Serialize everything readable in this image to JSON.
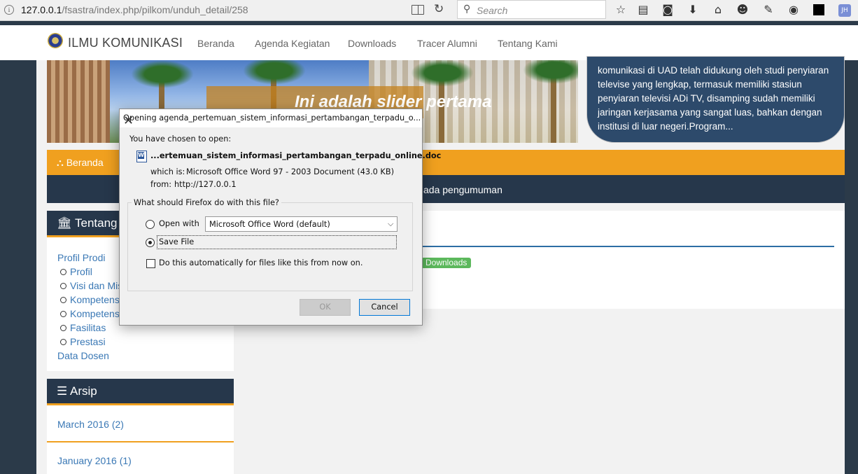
{
  "browser": {
    "url_host": "127.0.0.1",
    "url_path": "/fsastra/index.php/pilkom/unduh_detail/258",
    "search_placeholder": "Search",
    "profile_badge": "JH"
  },
  "site": {
    "brand": "ILMU KOMUNIKASI",
    "nav": [
      "Beranda",
      "Agenda Kegiatan",
      "Downloads",
      "Tracer Alumni",
      "Tentang Kami"
    ]
  },
  "slider": {
    "caption": "Ini adalah slider pertama"
  },
  "about": {
    "text": "komunikasi di UAD telah didukung oleh studi penyiaran televise yang lengkap, termasuk memiliki stasiun penyiaran televisi ADi TV, disamping sudah memiliki jaringan kerjasama yang sangat luas, bahkan dengan institusi di luar negeri.Program..."
  },
  "breadcrumb": {
    "label": "Beranda"
  },
  "news_ticker": {
    "text": "ada pengumuman"
  },
  "content": {
    "tag": "Downloads"
  },
  "sidebar": {
    "tentang": {
      "title": "Tentang K",
      "items": [
        {
          "label": "Profil Prodi",
          "sub": false
        },
        {
          "label": "Profil",
          "sub": true
        },
        {
          "label": "Visi dan Mis",
          "sub": true
        },
        {
          "label": "Kompetens",
          "sub": true
        },
        {
          "label": "Kompetens",
          "sub": true
        },
        {
          "label": "Fasilitas",
          "sub": true
        },
        {
          "label": "Prestasi",
          "sub": true
        },
        {
          "label": "Data Dosen",
          "sub": false
        }
      ]
    },
    "arsip": {
      "title": "Arsip",
      "items": [
        "March 2016 (2)",
        "January 2016 (1)"
      ]
    }
  },
  "dialog": {
    "title": "Opening agenda_pertemuan_sistem_informasi_pertambangan_terpadu_o...",
    "chosen_label": "You have chosen to open:",
    "filename": "...ertemuan_sistem_informasi_pertambangan_terpadu_online.doc",
    "which_is_label": "which is:",
    "which_is_value": "Microsoft Office Word 97 - 2003 Document (43.0 KB)",
    "from_label": "from:",
    "from_value": "http://127.0.0.1",
    "question": "What should Firefox do with this file?",
    "open_with_label": "Open with",
    "open_with_selected": "Microsoft Office Word (default)",
    "save_file_label": "Save File",
    "save_file_checked": true,
    "auto_label": "Do this automatically for files like this from now on.",
    "auto_checked": false,
    "ok_label": "OK",
    "cancel_label": "Cancel"
  }
}
